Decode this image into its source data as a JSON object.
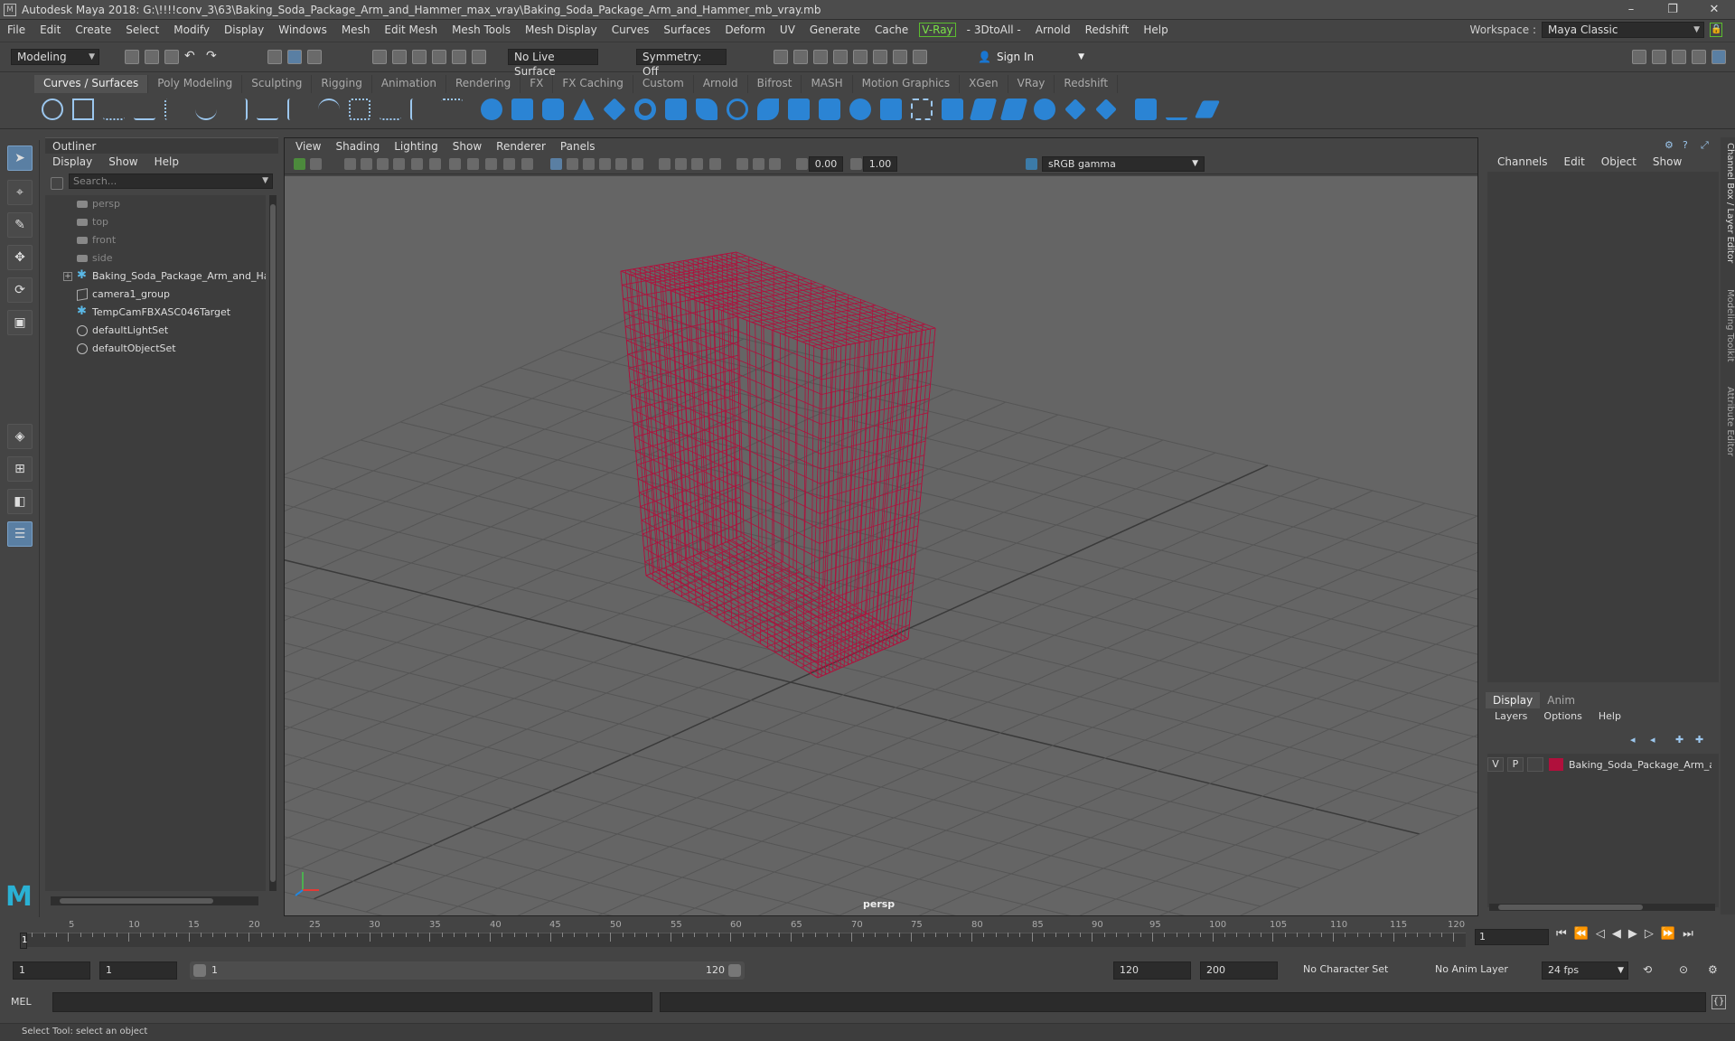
{
  "window": {
    "app_icon": "M",
    "title": "Autodesk Maya 2018: G:\\!!!!conv_3\\63\\Baking_Soda_Package_Arm_and_Hammer_max_vray\\Baking_Soda_Package_Arm_and_Hammer_mb_vray.mb",
    "minimize": "–",
    "maximize": "❐",
    "close": "✕"
  },
  "menubar": {
    "items": [
      "File",
      "Edit",
      "Create",
      "Select",
      "Modify",
      "Display",
      "Windows",
      "Mesh",
      "Edit Mesh",
      "Mesh Tools",
      "Mesh Display",
      "Curves",
      "Surfaces",
      "Deform",
      "UV",
      "Generate",
      "Cache"
    ],
    "vray": "V-Ray",
    "extra": [
      "- 3DtoAll -",
      "Arnold",
      "Redshift",
      "Help"
    ]
  },
  "workspace": {
    "label": "Workspace :",
    "value": "Maya Classic"
  },
  "statusline": {
    "mode": "Modeling",
    "live_surface": "No Live Surface",
    "symmetry": "Symmetry: Off",
    "sign_in": "Sign In"
  },
  "shelf": {
    "tabs": [
      "Curves / Surfaces",
      "Poly Modeling",
      "Sculpting",
      "Rigging",
      "Animation",
      "Rendering",
      "FX",
      "FX Caching",
      "Custom",
      "Arnold",
      "Bifrost",
      "MASH",
      "Motion Graphics",
      "XGen",
      "VRay",
      "Redshift"
    ],
    "active_tab": "Curves / Surfaces"
  },
  "outliner": {
    "title": "Outliner",
    "menu": [
      "Display",
      "Show",
      "Help"
    ],
    "search_placeholder": "Search...",
    "items": [
      {
        "label": "persp",
        "icon": "camera-icon",
        "dim": true
      },
      {
        "label": "top",
        "icon": "camera-icon",
        "dim": true
      },
      {
        "label": "front",
        "icon": "camera-icon",
        "dim": true
      },
      {
        "label": "side",
        "icon": "camera-icon",
        "dim": true
      },
      {
        "label": "Baking_Soda_Package_Arm_and_Hammer",
        "icon": "transform-icon",
        "dim": false,
        "expandable": true
      },
      {
        "label": "camera1_group",
        "icon": "group-icon",
        "dim": false
      },
      {
        "label": "TempCamFBXASC046Target",
        "icon": "transform-icon",
        "dim": false
      },
      {
        "label": "defaultLightSet",
        "icon": "set-icon",
        "dim": false
      },
      {
        "label": "defaultObjectSet",
        "icon": "set-icon",
        "dim": false
      }
    ]
  },
  "viewport": {
    "menu": [
      "View",
      "Shading",
      "Lighting",
      "Show",
      "Renderer",
      "Panels"
    ],
    "exposure": "0.00",
    "gamma": "1.00",
    "color_space": "sRGB gamma",
    "camera_label": "persp",
    "wire_color": "#b0103c"
  },
  "channelbox": {
    "menu": [
      "Channels",
      "Edit",
      "Object",
      "Show"
    ],
    "side_tabs": [
      "Channel Box / Layer Editor",
      "Modeling Toolkit",
      "Attribute Editor"
    ]
  },
  "layer_editor": {
    "tabs": [
      "Display",
      "Anim"
    ],
    "active_tab": "Display",
    "menu": [
      "Layers",
      "Options",
      "Help"
    ],
    "layer": {
      "v": "V",
      "p": "P",
      "name": "Baking_Soda_Package_Arm_and_Hammer",
      "color": "#b0103c"
    }
  },
  "timeline": {
    "tick_labels": [
      "5",
      "10",
      "15",
      "20",
      "25",
      "30",
      "35",
      "40",
      "45",
      "50",
      "55",
      "60",
      "65",
      "70",
      "75",
      "80",
      "85",
      "90",
      "95",
      "100",
      "105",
      "110",
      "115",
      "120"
    ],
    "current_frame": "1",
    "current_field": "1"
  },
  "range": {
    "start": "1",
    "start2": "1",
    "slider_start": "1",
    "slider_end": "120",
    "end": "120",
    "end2": "200",
    "character_set": "No Character Set",
    "anim_layer": "No Anim Layer",
    "fps": "24 fps"
  },
  "cmdline": {
    "label": "MEL"
  },
  "helpline": {
    "text": "Select Tool: select an object"
  }
}
